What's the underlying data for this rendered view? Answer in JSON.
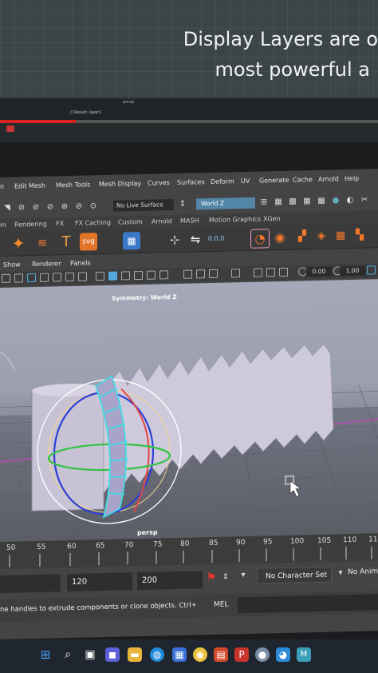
{
  "video": {
    "caption_line1": "Display Layers are o",
    "caption_line2": "most powerful a",
    "bar_label": "persp",
    "bar_label2": "// Result: layer1",
    "progress": 0.2
  },
  "menubar": {
    "items": [
      "n",
      "Edit Mesh",
      "Mesh Tools",
      "Mesh Display",
      "Curves",
      "Surfaces",
      "Deform",
      "UV",
      "Generate",
      "Cache",
      "Arnold",
      "Help"
    ]
  },
  "statusline": {
    "live_surface": "No Live Surface",
    "symmetry": "World Z"
  },
  "shelf_tabs": [
    "m",
    "Rendering",
    "FX",
    "FX Caching",
    "Custom",
    "Arnold",
    "MASH",
    "Motion Graphics",
    "XGen"
  ],
  "shelf": {
    "svg_label": "svg",
    "text_label": "T",
    "value_label": "0.0,0"
  },
  "panel_menu": [
    "Show",
    "Renderer",
    "Panels"
  ],
  "panel_toolbar": {
    "field1": "0.00",
    "field2": "1.00"
  },
  "viewport": {
    "symmetry_label": "Symmetry: World Z",
    "camera_label": "persp"
  },
  "timeline": {
    "ticks": [
      "50",
      "55",
      "60",
      "65",
      "70",
      "75",
      "80",
      "85",
      "90",
      "95",
      "100",
      "105",
      "110",
      "11"
    ]
  },
  "range": {
    "end_value": "120",
    "max_value": "200",
    "character_set": "No Character Set",
    "anim_layer": "No Anim"
  },
  "cmdline": {
    "help_text": "ne handles to extrude components or clone objects. Ctrl+S",
    "mel_label": "MEL"
  },
  "colors": {
    "accent_blue": "#5285a6",
    "viewport_bg": "#a5a8b8",
    "progress_red": "#dd2222"
  }
}
